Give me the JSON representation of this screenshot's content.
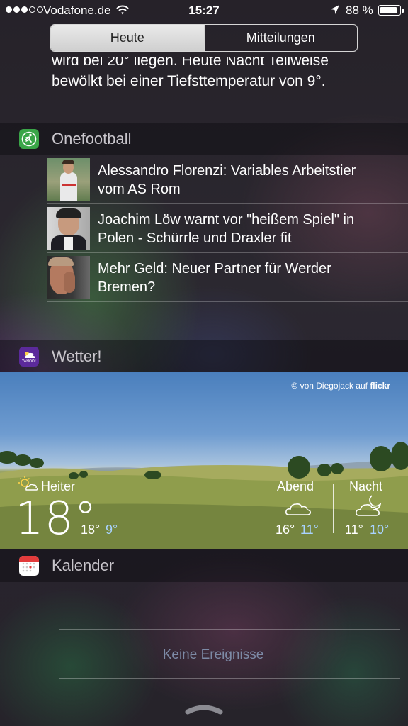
{
  "status_bar": {
    "carrier": "Vodafone.de",
    "time": "15:27",
    "battery": "88 %",
    "battery_level": 0.88,
    "signal_bars": 3
  },
  "segmented_control": {
    "tabs": [
      {
        "label": "Heute",
        "active": true
      },
      {
        "label": "Mitteilungen",
        "active": false
      }
    ]
  },
  "weather_summary": {
    "line1": "wird bei 20° liegen. Heute Nacht Teilweise",
    "line2": "bewölkt bei einer Tiefsttemperatur von 9°."
  },
  "onefootball": {
    "title": "Onefootball",
    "icon_color": "#3aa548",
    "items": [
      {
        "text": "Alessandro Florenzi: Variables Arbeitstier vom AS Rom",
        "line1": "Alessandro Florenzi: Variables Arbeitstier",
        "line2": "vom AS Rom"
      },
      {
        "text": "Joachim Löw warnt vor \"heißem Spiel\" in Polen - Schürrle und Draxler fit",
        "line1": "Joachim Löw warnt vor \"heißem Spiel\" in",
        "line2": "Polen - Schürrle und Draxler fit"
      },
      {
        "text": "Mehr Geld: Neuer Partner für Werder Bremen?",
        "line1": "Mehr Geld: Neuer Partner für Werder",
        "line2": "Bremen?"
      }
    ]
  },
  "wetter": {
    "title": "Wetter!",
    "icon_label": "YAHOO!",
    "icon_color": "#5b2a9b",
    "credit": "© von Diegojack auf",
    "credit_brand": "flickr",
    "now": {
      "condition": "Heiter",
      "temp": "18°",
      "high": "18°",
      "low": "9°"
    },
    "evening": {
      "label": "Abend",
      "high": "16°",
      "low": "11°"
    },
    "night": {
      "label": "Nacht",
      "high": "11°",
      "low": "10°"
    }
  },
  "kalender": {
    "title": "Kalender",
    "icon_color": "#e23b3b",
    "empty_text": "Keine Ereignisse"
  },
  "icons": [
    "wifi-icon",
    "location-arrow-icon",
    "battery-icon",
    "onefootball-icon",
    "yahoo-weather-icon",
    "calendar-icon",
    "partly-sunny-icon",
    "cloud-icon",
    "cloud-moon-icon",
    "grabber-icon"
  ]
}
